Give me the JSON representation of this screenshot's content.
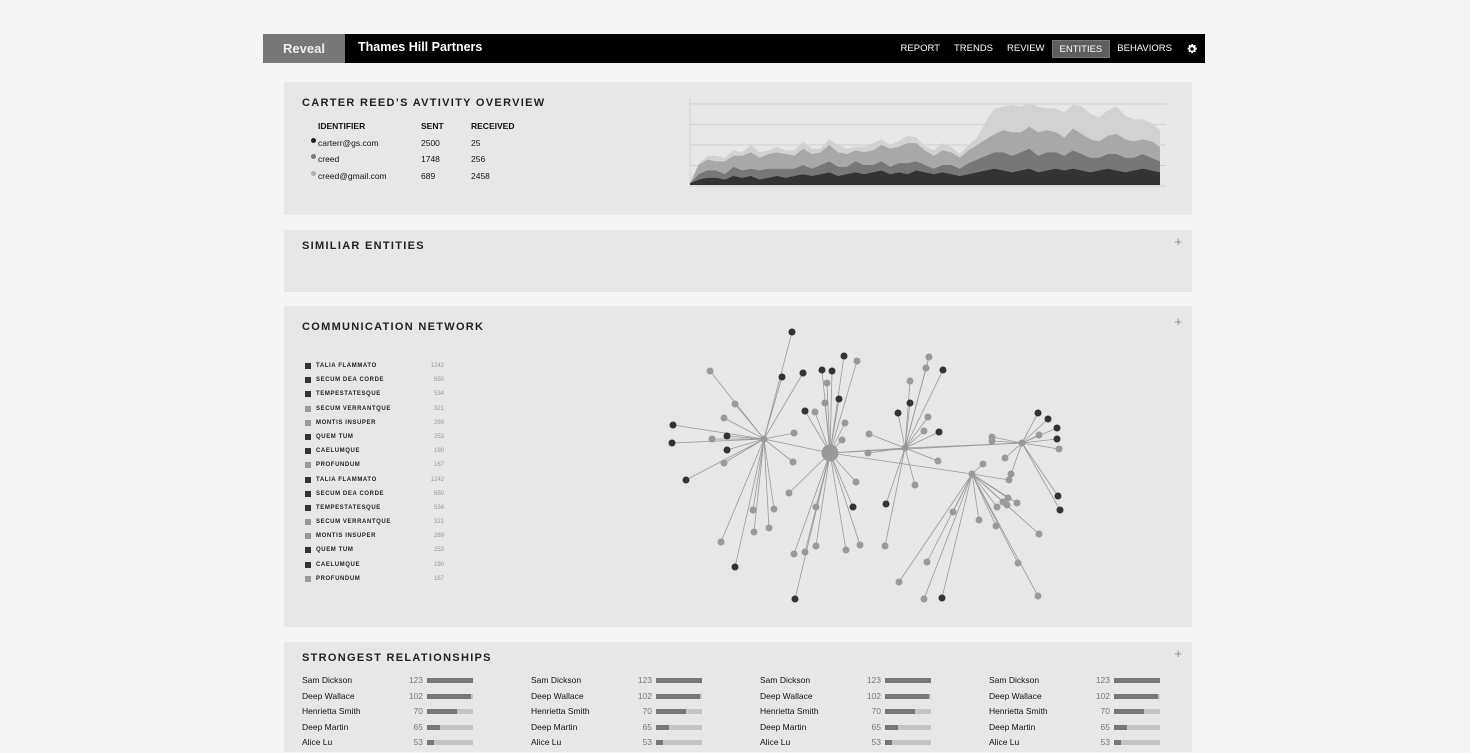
{
  "app": {
    "brand": "Reveal",
    "company": "Thames Hill Partners",
    "nav": [
      "REPORT",
      "TRENDS",
      "REVIEW",
      "ENTITIES",
      "BEHAVIORS"
    ],
    "active_nav": "ENTITIES"
  },
  "overview": {
    "title": "CARTER REED’S AVTIVITY OVERVIEW",
    "headers": {
      "identifier": "IDENTIFIER",
      "sent": "SENT",
      "received": "RECEIVED"
    },
    "rows": [
      {
        "identifier": "carterr@gs.com",
        "sent": "2500",
        "received": "25",
        "color": "#222222"
      },
      {
        "identifier": "creed",
        "sent": "1748",
        "received": "256",
        "color": "#777777"
      },
      {
        "identifier": "creed@gmail.com",
        "sent": "689",
        "received": "2458",
        "color": "#b0b0b0"
      }
    ],
    "chart_data": {
      "type": "area",
      "stacked": true,
      "grid": true,
      "series": [
        {
          "color": "#333333",
          "values": [
            1,
            3,
            4,
            4,
            3,
            5,
            4,
            5,
            3,
            4,
            5,
            4,
            5,
            6,
            5,
            6,
            7,
            5,
            6,
            7,
            6,
            7,
            8,
            6,
            7,
            6,
            8,
            7,
            6,
            7,
            6,
            5,
            6,
            7,
            8,
            9,
            8,
            7,
            8,
            9,
            7,
            8,
            9,
            8,
            9,
            8,
            7,
            8,
            9,
            8,
            7,
            8,
            9,
            8,
            7
          ]
        },
        {
          "color": "#777777",
          "values": [
            0,
            3,
            4,
            4,
            3,
            5,
            4,
            4,
            5,
            5,
            4,
            5,
            4,
            5,
            4,
            5,
            6,
            5,
            4,
            6,
            5,
            4,
            5,
            4,
            5,
            6,
            5,
            4,
            3,
            4,
            5,
            4,
            6,
            7,
            8,
            9,
            10,
            9,
            10,
            11,
            9,
            10,
            9,
            8,
            10,
            9,
            8,
            7,
            8,
            9,
            8,
            7,
            8,
            7,
            6
          ]
        },
        {
          "color": "#a8a8a8",
          "values": [
            0,
            5,
            6,
            5,
            7,
            6,
            8,
            9,
            7,
            8,
            9,
            8,
            7,
            9,
            8,
            7,
            9,
            8,
            7,
            6,
            7,
            8,
            9,
            10,
            9,
            11,
            10,
            8,
            7,
            8,
            7,
            6,
            7,
            8,
            9,
            10,
            12,
            13,
            11,
            12,
            13,
            12,
            11,
            10,
            12,
            11,
            10,
            9,
            10,
            11,
            10,
            9,
            8,
            9,
            8
          ]
        },
        {
          "color": "#d2d2d2",
          "values": [
            0,
            1,
            2,
            3,
            2,
            3,
            2,
            4,
            3,
            2,
            3,
            2,
            3,
            4,
            3,
            2,
            3,
            4,
            3,
            2,
            3,
            4,
            3,
            2,
            3,
            4,
            3,
            2,
            3,
            4,
            3,
            2,
            3,
            4,
            10,
            14,
            13,
            15,
            14,
            13,
            14,
            12,
            13,
            14,
            13,
            15,
            14,
            13,
            14,
            15,
            13,
            12,
            11,
            10,
            9
          ]
        }
      ]
    }
  },
  "similar": {
    "title": "SIMILIAR ENTITIES",
    "plus": "+"
  },
  "network": {
    "title": "COMMUNICATION NETWORK",
    "plus": "+",
    "legend": [
      {
        "label": "TALIA FLAMMATO",
        "count": "1242",
        "color": "#333333"
      },
      {
        "label": "SECUM DEA CORDE",
        "count": "650",
        "color": "#333333"
      },
      {
        "label": "TEMPESTATESQUE",
        "count": "534",
        "color": "#333333"
      },
      {
        "label": "SECUM VERRANTQUE",
        "count": "321",
        "color": "#999999"
      },
      {
        "label": "MONTIS INSUPER",
        "count": "289",
        "color": "#999999"
      },
      {
        "label": "QUEM TUM",
        "count": "253",
        "color": "#333333"
      },
      {
        "label": "CAELUMQUE",
        "count": "190",
        "color": "#333333"
      },
      {
        "label": "PROFUNDUM",
        "count": "167",
        "color": "#999999"
      },
      {
        "label": "TALIA FLAMMATO",
        "count": "1242",
        "color": "#333333"
      },
      {
        "label": "SECUM DEA CORDE",
        "count": "650",
        "color": "#333333"
      },
      {
        "label": "TEMPESTATESQUE",
        "count": "534",
        "color": "#333333"
      },
      {
        "label": "SECUM VERRANTQUE",
        "count": "321",
        "color": "#999999"
      },
      {
        "label": "MONTIS INSUPER",
        "count": "289",
        "color": "#999999"
      },
      {
        "label": "QUEM TUM",
        "count": "253",
        "color": "#333333"
      },
      {
        "label": "CAELUMQUE",
        "count": "190",
        "color": "#333333"
      },
      {
        "label": "PROFUNDUM",
        "count": "167",
        "color": "#999999"
      }
    ]
  },
  "relationships": {
    "title": "STRONGEST RELATIONSHIPS",
    "plus": "+",
    "columns": [
      [
        {
          "name": "Sam Dickson",
          "value": "123",
          "fill": 1.0
        },
        {
          "name": "Deep Wallace",
          "value": "102",
          "fill": 0.95
        },
        {
          "name": "Henrietta Smith",
          "value": "70",
          "fill": 0.65
        },
        {
          "name": "Deep Martin",
          "value": "65",
          "fill": 0.28
        },
        {
          "name": "Alice Lu",
          "value": "53",
          "fill": 0.15
        }
      ],
      [
        {
          "name": "Sam Dickson",
          "value": "123",
          "fill": 1.0
        },
        {
          "name": "Deep Wallace",
          "value": "102",
          "fill": 0.95
        },
        {
          "name": "Henrietta Smith",
          "value": "70",
          "fill": 0.65
        },
        {
          "name": "Deep Martin",
          "value": "65",
          "fill": 0.28
        },
        {
          "name": "Alice Lu",
          "value": "53",
          "fill": 0.15
        }
      ],
      [
        {
          "name": "Sam Dickson",
          "value": "123",
          "fill": 1.0
        },
        {
          "name": "Deep Wallace",
          "value": "102",
          "fill": 0.95
        },
        {
          "name": "Henrietta Smith",
          "value": "70",
          "fill": 0.65
        },
        {
          "name": "Deep Martin",
          "value": "65",
          "fill": 0.28
        },
        {
          "name": "Alice Lu",
          "value": "53",
          "fill": 0.15
        }
      ],
      [
        {
          "name": "Sam Dickson",
          "value": "123",
          "fill": 1.0
        },
        {
          "name": "Deep Wallace",
          "value": "102",
          "fill": 0.95
        },
        {
          "name": "Henrietta Smith",
          "value": "70",
          "fill": 0.65
        },
        {
          "name": "Deep Martin",
          "value": "65",
          "fill": 0.28
        },
        {
          "name": "Alice Lu",
          "value": "53",
          "fill": 0.15
        }
      ]
    ]
  }
}
